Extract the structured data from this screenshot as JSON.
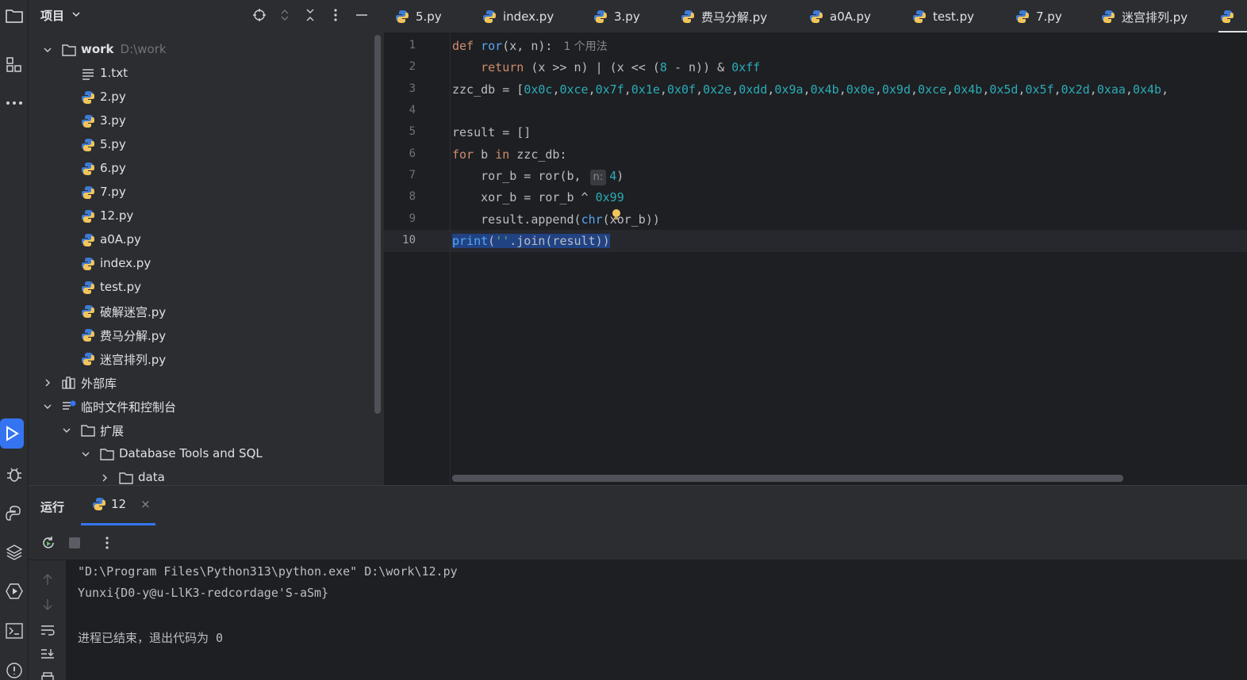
{
  "project": {
    "title": "项目",
    "tree": [
      {
        "label": "work",
        "path": "D:\\work",
        "kind": "folder-open",
        "depth": 0,
        "bold": true
      },
      {
        "label": "1.txt",
        "kind": "txt",
        "depth": 1
      },
      {
        "label": "2.py",
        "kind": "py",
        "depth": 1
      },
      {
        "label": "3.py",
        "kind": "py",
        "depth": 1
      },
      {
        "label": "5.py",
        "kind": "py",
        "depth": 1
      },
      {
        "label": "6.py",
        "kind": "py",
        "depth": 1
      },
      {
        "label": "7.py",
        "kind": "py",
        "depth": 1
      },
      {
        "label": "12.py",
        "kind": "py",
        "depth": 1
      },
      {
        "label": "a0A.py",
        "kind": "py",
        "depth": 1
      },
      {
        "label": "index.py",
        "kind": "py",
        "depth": 1
      },
      {
        "label": "test.py",
        "kind": "py",
        "depth": 1
      },
      {
        "label": "破解迷宫.py",
        "kind": "py",
        "depth": 1
      },
      {
        "label": "费马分解.py",
        "kind": "py",
        "depth": 1
      },
      {
        "label": "迷宫排列.py",
        "kind": "py",
        "depth": 1
      },
      {
        "label": "外部库",
        "kind": "lib-collapsed",
        "depth": 0
      },
      {
        "label": "临时文件和控制台",
        "kind": "scratch-open",
        "depth": 0
      },
      {
        "label": "扩展",
        "kind": "folder-open",
        "depth": 1
      },
      {
        "label": "Database Tools and SQL",
        "kind": "folder-open",
        "depth": 2
      },
      {
        "label": "data",
        "kind": "folder-collapsed",
        "depth": 3
      }
    ]
  },
  "tabs": [
    "5.py",
    "index.py",
    "3.py",
    "费马分解.py",
    "a0A.py",
    "test.py",
    "7.py",
    "迷宫排列.py"
  ],
  "editor": {
    "current_line": 10,
    "line_numbers": [
      "1",
      "2",
      "3",
      "4",
      "5",
      "6",
      "7",
      "8",
      "9",
      "10"
    ],
    "usage_hint": "1 个用法",
    "inlay_param": "n:",
    "byte_list": [
      "0x0c",
      "0xce",
      "0x7f",
      "0x1e",
      "0x0f",
      "0x2e",
      "0xdd",
      "0x9a",
      "0x4b",
      "0x0e",
      "0x9d",
      "0xce",
      "0x4b",
      "0x5d",
      "0x5f",
      "0x2d",
      "0xaa",
      "0x4b"
    ]
  },
  "run": {
    "title": "运行",
    "tab_label": "12",
    "close_glyph": "×",
    "output": [
      "\"D:\\Program Files\\Python313\\python.exe\" D:\\work\\12.py",
      "Yunxi{D0-y@u-LlK3-redcordage'S-aSm}",
      "",
      "进程已结束，退出代码为 0"
    ]
  },
  "colors": {
    "accent": "#3574f0",
    "keyword": "#cf8e6d",
    "function": "#56a8f5",
    "number": "#2aacb8",
    "string": "#6aab73",
    "selection": "#214283"
  }
}
